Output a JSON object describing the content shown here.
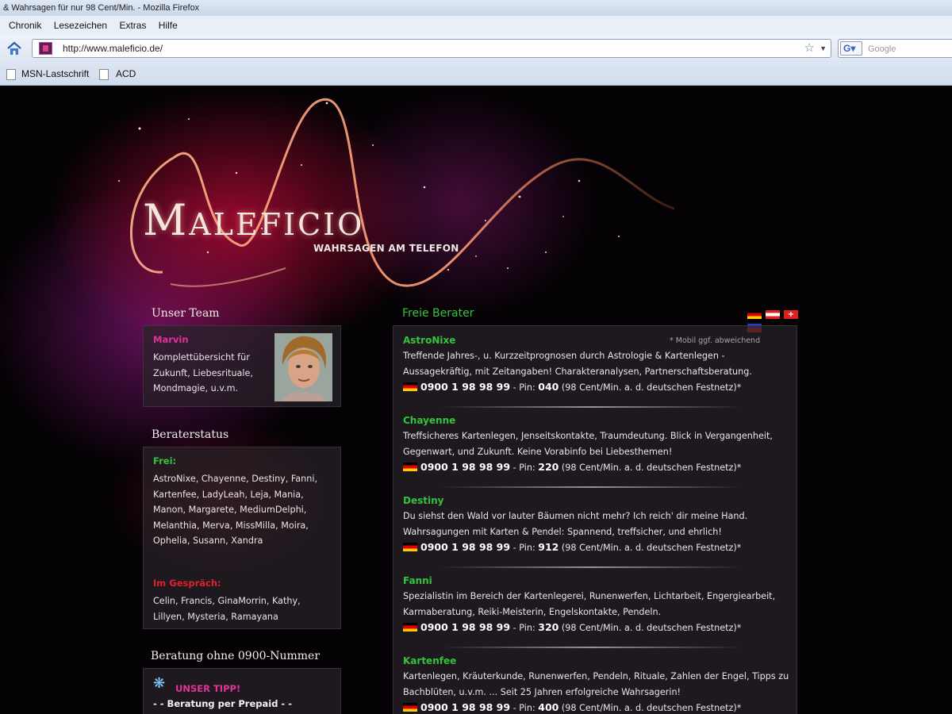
{
  "browser": {
    "title": "& Wahrsagen für nur 98 Cent/Min. - Mozilla Firefox",
    "menu": [
      "Chronik",
      "Lesezeichen",
      "Extras",
      "Hilfe"
    ],
    "url": "http://www.maleficio.de/",
    "search_placeholder": "Google",
    "bookmarks": [
      "MSN-Lastschrift",
      "ACD"
    ]
  },
  "site": {
    "logo": "Maleficio",
    "tagline": "WAHRSAGEN AM TELEFON"
  },
  "team": {
    "title": "Unser Team",
    "name": "Marvin",
    "description": "Komplettübersicht für Zukunft, Liebesrituale, Mondmagie, u.v.m."
  },
  "status": {
    "title": "Beraterstatus",
    "free_label": "Frei:",
    "free_list": "AstroNixe, Chayenne, Destiny, Fanni, Kartenfee, LadyLeah, Leja, Mania, Manon, Margarete, MediumDelphi, Melanthia, Merva, MissMilla, Moira, Ophelia, Susann, Xandra",
    "busy_label": "Im Gespräch:",
    "busy_list": "Celin, Francis, GinaMorrin, Kathy, Lillyen, Mysteria, Ramayana"
  },
  "prepaid": {
    "title": "Beratung ohne 0900-Nummer",
    "tipp": "UNSER TIPP!",
    "line": "- - Beratung per Prepaid - -"
  },
  "berater": {
    "title": "Freie Berater",
    "mobil_note": "* Mobil ggf. abweichend",
    "entries": [
      {
        "name": "AstroNixe",
        "desc": "Treffende Jahres-, u. Kurzzeitprognosen durch Astrologie & Kartenlegen - Aussagekräftig, mit Zeitangaben! Charakteranalysen, Partnerschaftsberatung.",
        "phone": "0900 1 98 98 99",
        "pin_label": " - Pin: ",
        "pin": "040",
        "price": " (98 Cent/Min. a. d. deutschen Festnetz)*"
      },
      {
        "name": "Chayenne",
        "desc": "Treffsicheres Kartenlegen, Jenseitskontakte, Traumdeutung. Blick in Vergangenheit, Gegenwart, und Zukunft. Keine Vorabinfo bei Liebesthemen!",
        "phone": "0900 1 98 98 99",
        "pin_label": " - Pin: ",
        "pin": "220",
        "price": " (98 Cent/Min. a. d. deutschen Festnetz)*"
      },
      {
        "name": "Destiny",
        "desc": "Du siehst den Wald vor lauter Bäumen nicht mehr? Ich reich' dir meine Hand. Wahrsagungen mit Karten & Pendel: Spannend, treffsicher, und ehrlich!",
        "phone": "0900 1 98 98 99",
        "pin_label": " - Pin: ",
        "pin": "912",
        "price": " (98 Cent/Min. a. d. deutschen Festnetz)*"
      },
      {
        "name": "Fanni",
        "desc": "Spezialistin im Bereich der Kartenlegerei, Runenwerfen, Lichtarbeit, Engergiearbeit, Karmaberatung, Reiki-Meisterin, Engelskontakte, Pendeln.",
        "phone": "0900 1 98 98 99",
        "pin_label": " - Pin: ",
        "pin": "320",
        "price": " (98 Cent/Min. a. d. deutschen Festnetz)*"
      },
      {
        "name": "Kartenfee",
        "desc": "Kartenlegen, Kräuterkunde, Runenwerfen, Pendeln, Rituale, Zahlen der Engel, Tipps zu Bachblüten, u.v.m. ... Seit 25 Jahren erfolgreiche Wahrsagerin!",
        "phone": "0900 1 98 98 99",
        "pin_label": " - Pin: ",
        "pin": "400",
        "price": " (98 Cent/Min. a. d. deutschen Festnetz)*"
      }
    ]
  }
}
